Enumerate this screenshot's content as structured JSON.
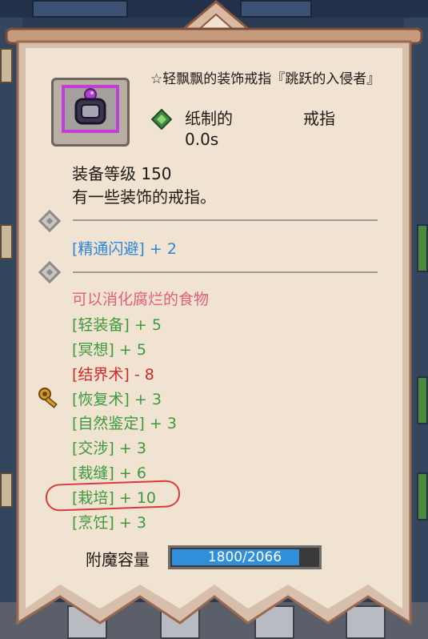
{
  "item": {
    "title": "☆轻飘飘的装饰戒指『跳跃的入侵者』",
    "material": "纸制的",
    "type": "戒指",
    "time": "0.0s",
    "equip_level": "装备等级 150",
    "description": "有一些装饰的戒指。",
    "icon": "ring-icon",
    "rarity_color": "#c13fd6"
  },
  "stats": {
    "bonus": "[精通闪避] + 2",
    "special": "可以消化腐烂的食物",
    "skills": [
      {
        "text": "[轻装备] + 5",
        "color": "green"
      },
      {
        "text": "[冥想] + 5",
        "color": "green"
      },
      {
        "text": "[结界术] - 8",
        "color": "red"
      },
      {
        "text": "[恢复术] + 3",
        "color": "green"
      },
      {
        "text": "[自然鉴定] + 3",
        "color": "green"
      },
      {
        "text": "[交涉] + 3",
        "color": "green"
      },
      {
        "text": "[裁缝] + 6",
        "color": "green"
      },
      {
        "text": "[栽培] + 10",
        "color": "green"
      },
      {
        "text": "[烹饪] + 3",
        "color": "green"
      }
    ]
  },
  "enchant": {
    "label": "附魔容量",
    "value": "1800/2066",
    "current": 1800,
    "max": 2066
  },
  "colors": {
    "parchment": "#f1e3d2",
    "banner_edge": "#a87456",
    "green": "#3d9a3b",
    "red": "#cf2a2a",
    "blue": "#2b86d8",
    "pink": "#e0607a",
    "circle": "#d93a3a"
  }
}
